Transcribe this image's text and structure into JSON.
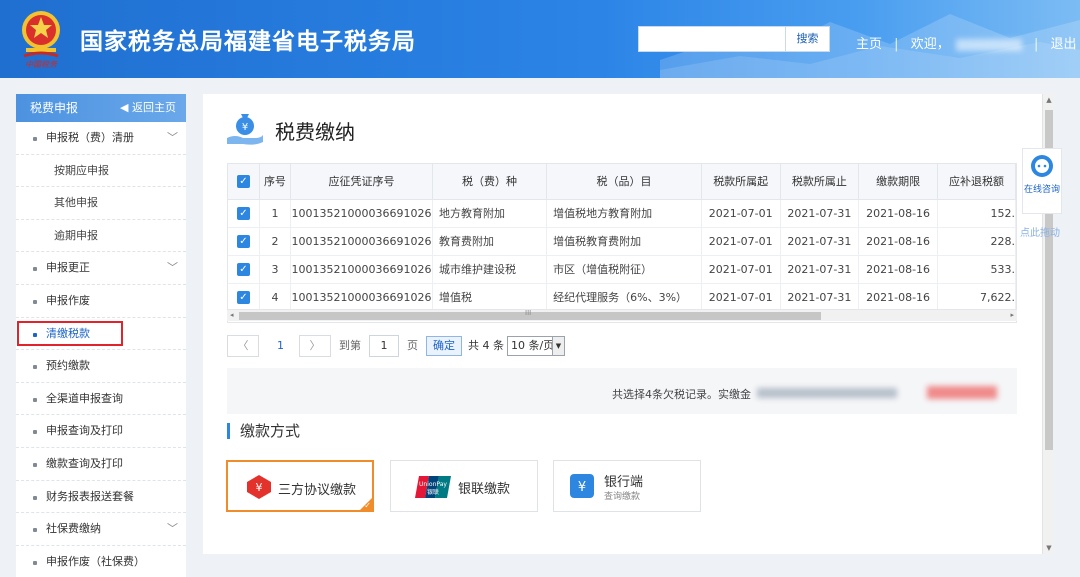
{
  "header": {
    "title": "国家税务总局福建省电子税务局",
    "search": {
      "value": "",
      "placeholder": ""
    },
    "search_button": "搜索",
    "home_link": "主页",
    "separator": "|",
    "welcome": "欢迎，",
    "logout": "退出"
  },
  "sidebar": {
    "title": "税费申报",
    "back_label": "返回主页",
    "items": [
      {
        "label": "申报税（费）清册",
        "expandable": true,
        "level": 1
      },
      {
        "label": "按期应申报",
        "level": 2
      },
      {
        "label": "其他申报",
        "level": 2
      },
      {
        "label": "逾期申报",
        "level": 2
      },
      {
        "label": "申报更正",
        "expandable": true,
        "level": 1
      },
      {
        "label": "申报作废",
        "level": 1
      },
      {
        "label": "清缴税款",
        "level": 1,
        "active": true
      },
      {
        "label": "预约缴款",
        "level": 1
      },
      {
        "label": "全渠道申报查询",
        "level": 1
      },
      {
        "label": "申报查询及打印",
        "level": 1
      },
      {
        "label": "缴款查询及打印",
        "level": 1
      },
      {
        "label": "财务报表报送套餐",
        "level": 1
      },
      {
        "label": "社保费缴纳",
        "expandable": true,
        "level": 1
      },
      {
        "label": "申报作废（社保费）",
        "level": 1
      }
    ]
  },
  "main": {
    "title": "税费缴纳",
    "table": {
      "headers": [
        "序号",
        "应征凭证序号",
        "税（费）种",
        "税（品）目",
        "税款所属起",
        "税款所属止",
        "缴款期限",
        "应补退税额"
      ],
      "rows": [
        {
          "no": "1",
          "voucher": "10013521000036691026",
          "tax_type": "地方教育附加",
          "item": "增值税地方教育附加",
          "start": "2021-07-01",
          "end": "2021-07-31",
          "deadline": "2021-08-16",
          "amount": "152."
        },
        {
          "no": "2",
          "voucher": "10013521000036691026",
          "tax_type": "教育费附加",
          "item": "增值税教育费附加",
          "start": "2021-07-01",
          "end": "2021-07-31",
          "deadline": "2021-08-16",
          "amount": "228."
        },
        {
          "no": "3",
          "voucher": "10013521000036691026",
          "tax_type": "城市维护建设税",
          "item": "市区（增值税附征）",
          "start": "2021-07-01",
          "end": "2021-07-31",
          "deadline": "2021-08-16",
          "amount": "533."
        },
        {
          "no": "4",
          "voucher": "10013521000036691026",
          "tax_type": "增值税",
          "item": "经纪代理服务（6%、3%）",
          "start": "2021-07-01",
          "end": "2021-07-31",
          "deadline": "2021-08-16",
          "amount": "7,622."
        }
      ],
      "scroll_arrow_left": "◂",
      "scroll_arrow_right": "▸",
      "scroll_grip": "III"
    },
    "pager": {
      "prev": "〈",
      "page": "1",
      "next": "〉",
      "goto": "到第",
      "page_input": "1",
      "page_unit": "页",
      "confirm": "确定",
      "total": "共 4 条",
      "page_size": "10 条/页"
    },
    "summary": "共选择4条欠税记录。实缴金",
    "payment_section_title": "缴款方式",
    "payment_methods": [
      {
        "label": "三方协议缴款",
        "selected": true
      },
      {
        "label": "银联缴款",
        "selected": false
      },
      {
        "label": "银行端",
        "sub": "查询缴款",
        "selected": false
      }
    ]
  },
  "floating": {
    "help": "在线咨询",
    "hint": "点此拖动"
  },
  "icons": {
    "emblem": "national-tax-emblem-icon",
    "page": "money-bag-hand-icon",
    "back": "back-arrow-icon",
    "three_party": "three-party-payment-icon",
    "unionpay": "unionpay-logo-icon",
    "bank": "bank-yuan-icon"
  },
  "colors": {
    "header_blue": "#2b84e6",
    "active": "#1d64c8",
    "highlight_red": "#e0242b",
    "selected_orange": "#f08c2a",
    "checkbox": "#2d86e0"
  }
}
